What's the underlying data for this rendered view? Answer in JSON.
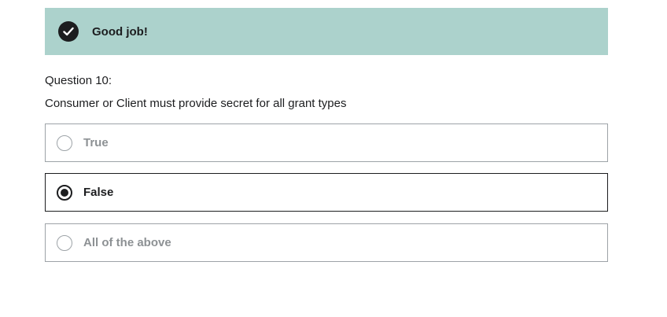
{
  "feedback": {
    "icon": "check-circle-icon",
    "message": "Good job!",
    "color": "#acd2cc"
  },
  "question": {
    "number_label": "Question 10:",
    "text": "Consumer or Client must provide secret for all grant types"
  },
  "options": [
    {
      "label": "True",
      "selected": false
    },
    {
      "label": "False",
      "selected": true
    },
    {
      "label": "All of the above",
      "selected": false
    }
  ]
}
